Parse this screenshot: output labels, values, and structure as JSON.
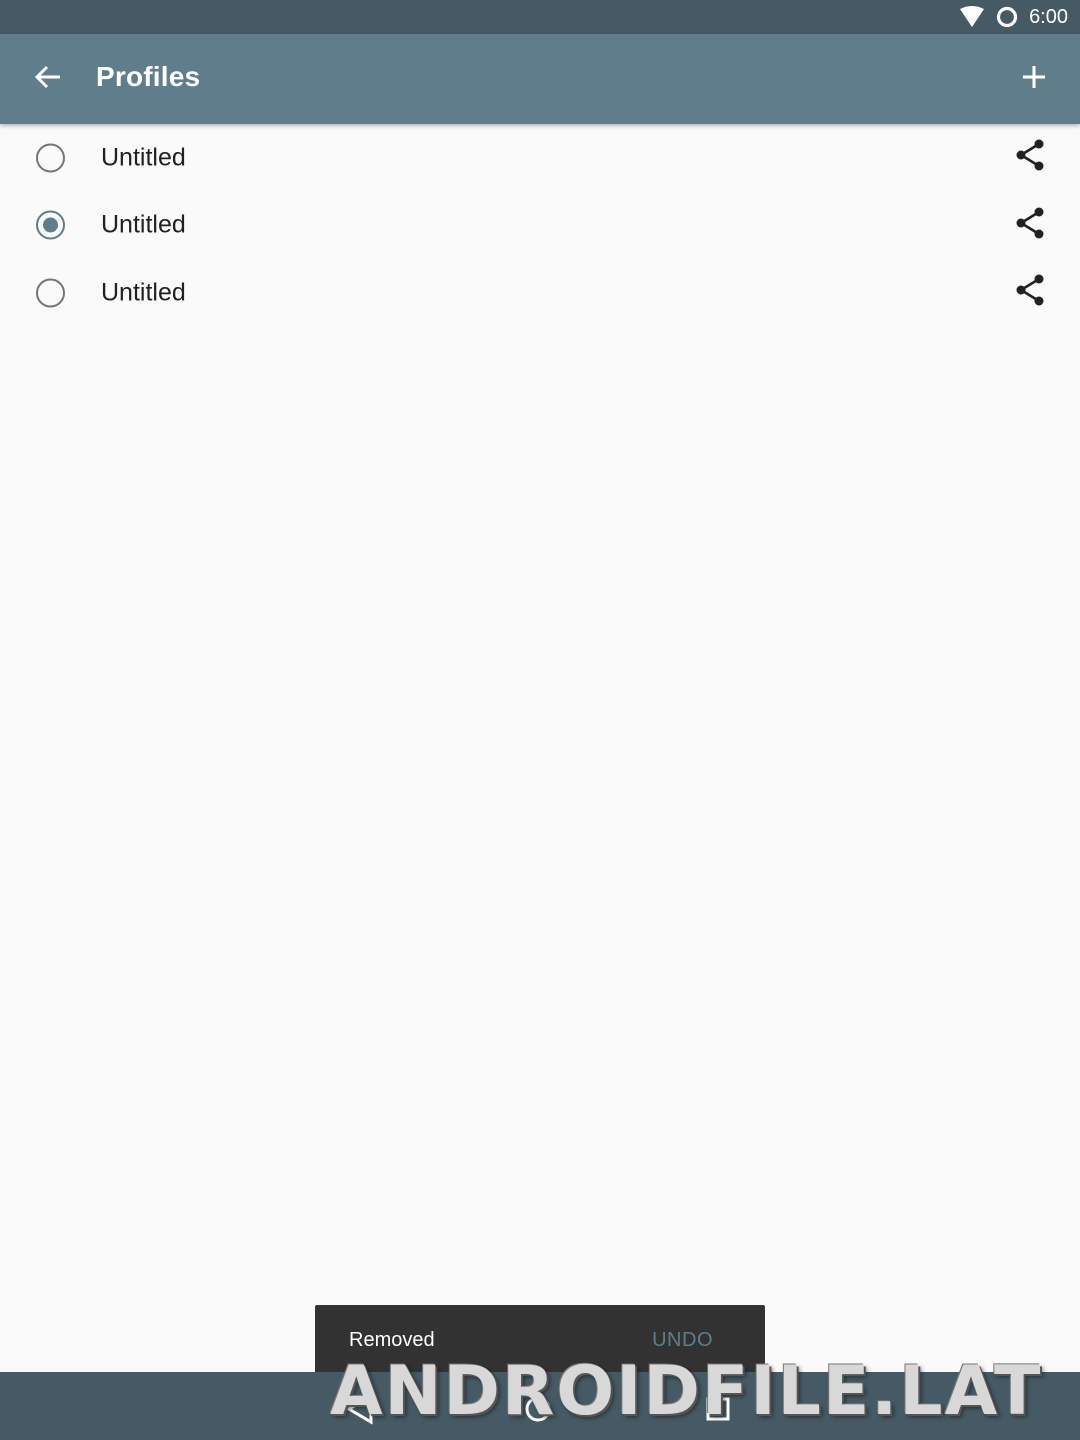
{
  "status_bar": {
    "time": "6:00",
    "icons": [
      "wifi-icon",
      "sync-ring-icon"
    ]
  },
  "app_bar": {
    "title": "Profiles",
    "back_icon": "arrow-back-icon",
    "add_icon": "plus-icon"
  },
  "profiles": [
    {
      "name": "Untitled",
      "selected": false
    },
    {
      "name": "Untitled",
      "selected": true
    },
    {
      "name": "Untitled",
      "selected": false
    }
  ],
  "share_icon": "share-icon",
  "snackbar": {
    "message": "Removed",
    "action": "UNDO"
  },
  "nav_bar": {
    "icons": [
      "nav-back-icon",
      "nav-home-icon",
      "nav-recents-icon"
    ]
  },
  "watermark": {
    "text": "ANDROIDFILE.LAT"
  },
  "colors": {
    "primary": "#607d8b",
    "primary_dark": "#455a64",
    "background": "#fafafa",
    "snackbar": "#323232"
  }
}
